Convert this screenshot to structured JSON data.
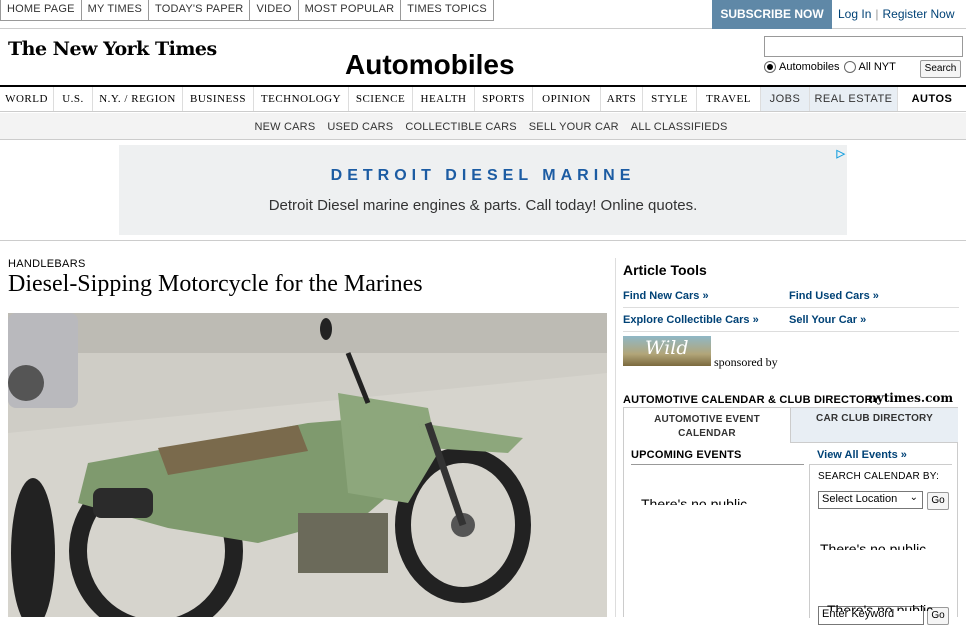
{
  "top_links": [
    "HOME PAGE",
    "MY TIMES",
    "TODAY'S PAPER",
    "VIDEO",
    "MOST POPULAR",
    "TIMES TOPICS"
  ],
  "subscribe_label": "SUBSCRIBE NOW",
  "login": {
    "log_in": "Log In",
    "register": "Register Now"
  },
  "logo_text": "The New York Times",
  "section_title": "Automobiles",
  "search": {
    "value": "",
    "radio_automobiles": "Automobiles",
    "radio_all": "All NYT",
    "button": "Search"
  },
  "nav": [
    "WORLD",
    "U.S.",
    "N.Y. / REGION",
    "BUSINESS",
    "TECHNOLOGY",
    "SCIENCE",
    "HEALTH",
    "SPORTS",
    "OPINION",
    "ARTS",
    "STYLE",
    "TRAVEL",
    "JOBS",
    "REAL ESTATE",
    "AUTOS"
  ],
  "subnav": [
    "NEW CARS",
    "USED CARS",
    "COLLECTIBLE CARS",
    "SELL YOUR CAR",
    "ALL CLASSIFIEDS"
  ],
  "ad": {
    "title": "DETROIT DIESEL MARINE",
    "text": "Detroit Diesel marine engines & parts. Call today! Online quotes."
  },
  "article": {
    "kicker": "HANDLEBARS",
    "headline": "Diesel-Sipping Motorcycle for the Marines"
  },
  "tools": {
    "title": "Article Tools",
    "links": [
      [
        "Find New Cars »",
        "Find Used Cars »"
      ],
      [
        "Explore Collectible Cars »",
        "Sell Your Car »"
      ]
    ],
    "sponsor_logo": "Wild",
    "sponsored_by": "sponsored by"
  },
  "calendar": {
    "title": "AUTOMOTIVE CALENDAR & CLUB DIRECTORY",
    "brand": "nytimes.com",
    "tab_events": "AUTOMOTIVE EVENT CALENDAR",
    "tab_clubs": "CAR CLUB DIRECTORY",
    "upcoming": "UPCOMING EVENTS",
    "view_all": "View All Events »",
    "search_label": "SEARCH CALENDAR BY:",
    "select_location": "Select Location",
    "go": "Go",
    "keyword_placeholder": "Enter Keyword",
    "no_public": "There's no public"
  },
  "colors": {
    "accent_blue": "#004276",
    "subscribe_bg": "#5f88a7",
    "ad_blue": "#1c5ca3"
  }
}
